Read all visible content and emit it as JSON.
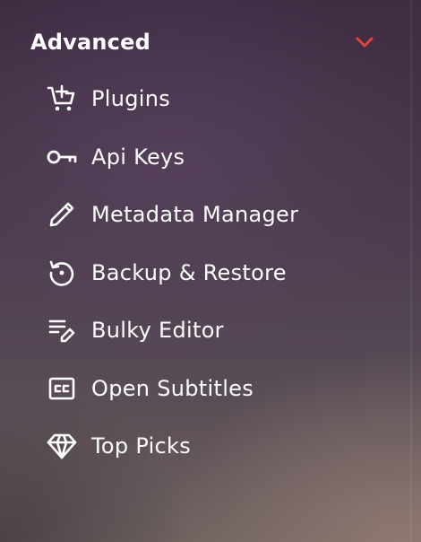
{
  "section": {
    "title": "Advanced",
    "accent_color": "#e0453a",
    "expanded": true,
    "items": [
      {
        "label": "Plugins",
        "icon": "cart-plus-icon"
      },
      {
        "label": "Api Keys",
        "icon": "key-icon"
      },
      {
        "label": "Metadata Manager",
        "icon": "pencil-icon"
      },
      {
        "label": "Backup & Restore",
        "icon": "restore-icon"
      },
      {
        "label": "Bulky Editor",
        "icon": "list-edit-icon"
      },
      {
        "label": "Open Subtitles",
        "icon": "closed-captions-icon"
      },
      {
        "label": "Top Picks",
        "icon": "diamond-icon"
      }
    ]
  }
}
